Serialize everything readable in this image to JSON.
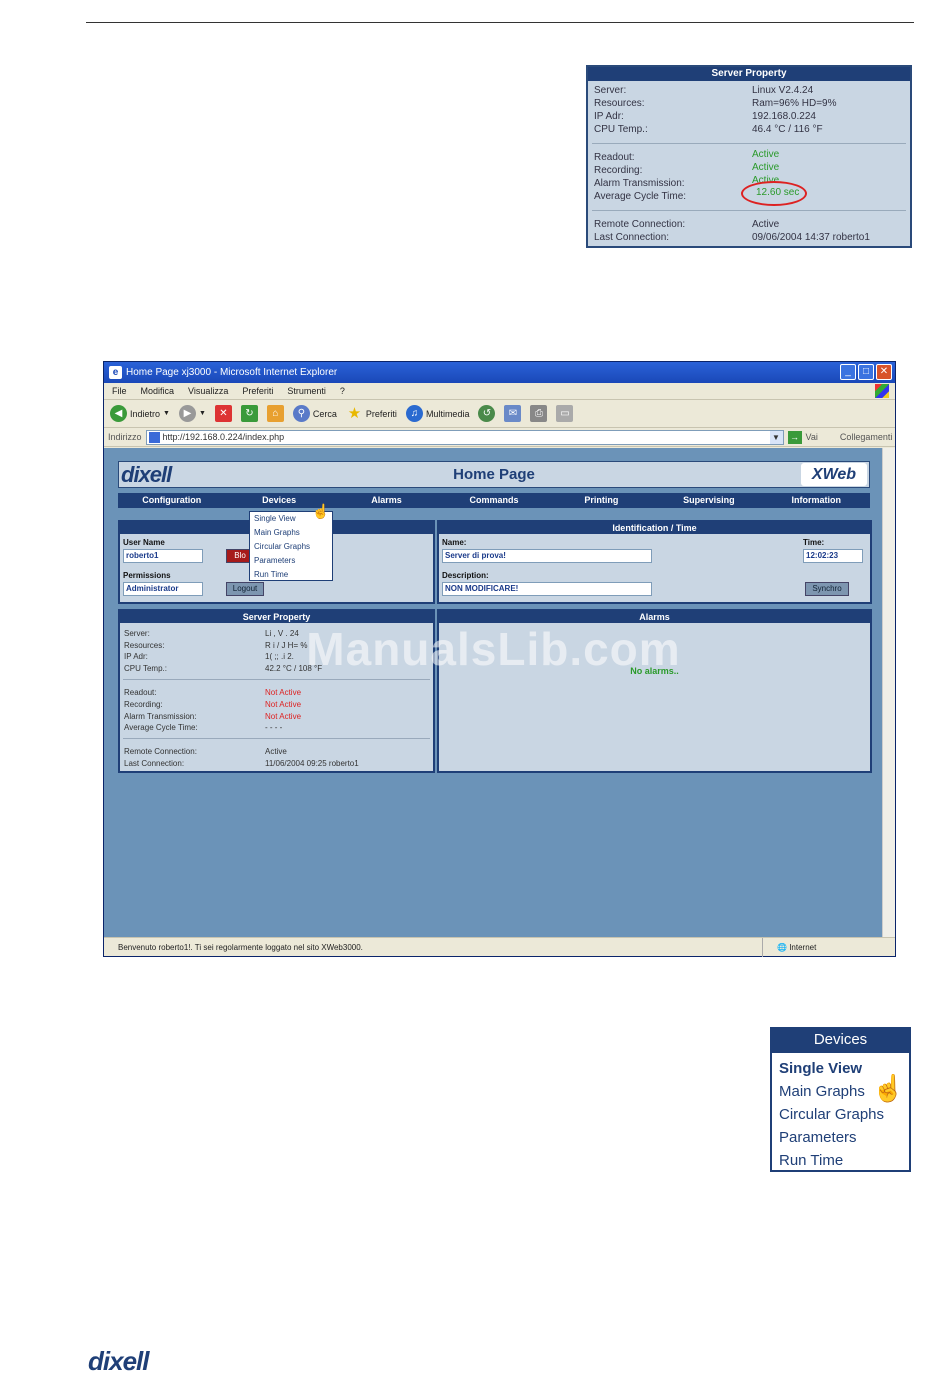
{
  "server_property_panel": {
    "title": "Server Property",
    "rows": [
      {
        "k": "Server:",
        "v": "Linux V2.4.24"
      },
      {
        "k": "Resources:",
        "v": "Ram=96%  HD=9%"
      },
      {
        "k": "IP Adr:",
        "v": "192.168.0.224"
      },
      {
        "k": "CPU Temp.:",
        "v": "46.4 °C / 116 °F"
      }
    ],
    "status_rows": [
      {
        "k": "Readout:",
        "v": "Active"
      },
      {
        "k": "Recording:",
        "v": "Active"
      },
      {
        "k": "Alarm Transmission:",
        "v": "Active"
      },
      {
        "k": "Average Cycle Time:",
        "v": "12.60 sec"
      }
    ],
    "conn_rows": [
      {
        "k": "Remote Connection:",
        "v": "Active"
      },
      {
        "k": "Last Connection:",
        "v": "09/06/2004 14:37 roberto1"
      }
    ]
  },
  "ie": {
    "window_title": "Home Page xj3000 - Microsoft Internet Explorer",
    "menu": [
      "File",
      "Modifica",
      "Visualizza",
      "Preferiti",
      "Strumenti",
      "?"
    ],
    "toolbar": {
      "back": "Indietro",
      "search": "Cerca",
      "favorites": "Preferiti",
      "media": "Multimedia"
    },
    "address_label": "Indirizzo",
    "address_url": "http://192.168.0.224/index.php",
    "go_label": "Vai",
    "links_label": "Collegamenti",
    "status_text": "Benvenuto roberto1!. Ti sei regolarmente loggato nel sito XWeb3000.",
    "zone_text": "Internet"
  },
  "web": {
    "logo": "dixell",
    "title": "Home Page",
    "xweb_logo": "XWeb",
    "nav": [
      "Configuration",
      "Devices",
      "Alarms",
      "Commands",
      "Printing",
      "Supervising",
      "Information"
    ],
    "user_box": {
      "title": "Se",
      "user_label": "User Name",
      "user_value": "roberto1",
      "block_label": "Blo",
      "permissions_label": "Permissions",
      "permissions_value": "Administrator",
      "logout_label": "Logout"
    },
    "ident_box": {
      "title": "Identification / Time",
      "name_label": "Name:",
      "name_value": "Server di prova!",
      "time_label": "Time:",
      "time_value": "12:02:23",
      "desc_label": "Description:",
      "desc_value": "NON MODIFICARE!",
      "sync_label": "Synchro"
    },
    "server_box": {
      "title": "Server Property",
      "rows": [
        {
          "k": "Server:",
          "v": "Li  , V  . 24"
        },
        {
          "k": "Resources:",
          "v": "R  i  /  J    H=  %"
        },
        {
          "k": "IP Adr:",
          "v": "1(  ;;   .i   2."
        },
        {
          "k": "CPU Temp.:",
          "v": "42.2 °C / 108 °F"
        }
      ],
      "status_rows": [
        {
          "k": "Readout:",
          "v": "Not Active"
        },
        {
          "k": "Recording:",
          "v": "Not Active"
        },
        {
          "k": "Alarm Transmission:",
          "v": "Not Active"
        },
        {
          "k": "Average Cycle Time:",
          "v": "- - - -"
        }
      ],
      "conn_rows": [
        {
          "k": "Remote Connection:",
          "v": "Active"
        },
        {
          "k": "Last Connection:",
          "v": "11/06/2004 09:25 roberto1"
        }
      ]
    },
    "alarms_box": {
      "title": "Alarms",
      "message": "No alarms.."
    },
    "dropdown": [
      "Single View",
      "Main Graphs",
      "Circular Graphs",
      "Parameters",
      "Run Time"
    ]
  },
  "watermark": "ManualsLib.com",
  "devices_panel": {
    "title": "Devices",
    "items": [
      "Single View",
      "Main Graphs",
      "Circular Graphs",
      "Parameters",
      "Run Time"
    ]
  },
  "footer_logo": "dixell"
}
